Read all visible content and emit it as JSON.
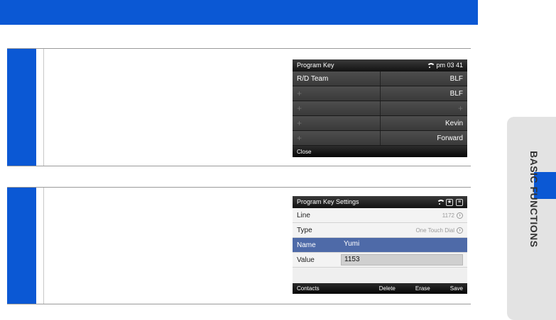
{
  "side_tab": {
    "label": "BASIC FUNCTIONS"
  },
  "screen1": {
    "title": "Program Key",
    "time": "pm 03 41",
    "rows": [
      {
        "left": "R/D Team",
        "right": "BLF"
      },
      {
        "left": "+",
        "right": "BLF"
      },
      {
        "left": "+",
        "right": "+"
      },
      {
        "left": "+",
        "right": "Kevin"
      },
      {
        "left": "+",
        "right": "Forward"
      }
    ],
    "bottom_left": "Close"
  },
  "screen2": {
    "title": "Program Key Settings",
    "rows": {
      "line": {
        "label": "Line",
        "value": "1172"
      },
      "type": {
        "label": "Type",
        "value": "One Touch Dial"
      },
      "name": {
        "label": "Name",
        "value": "Yumi"
      },
      "value": {
        "label": "Value",
        "value": "1153"
      }
    },
    "softkeys": {
      "contacts": "Contacts",
      "delete": "Delete",
      "erase": "Erase",
      "save": "Save"
    }
  }
}
